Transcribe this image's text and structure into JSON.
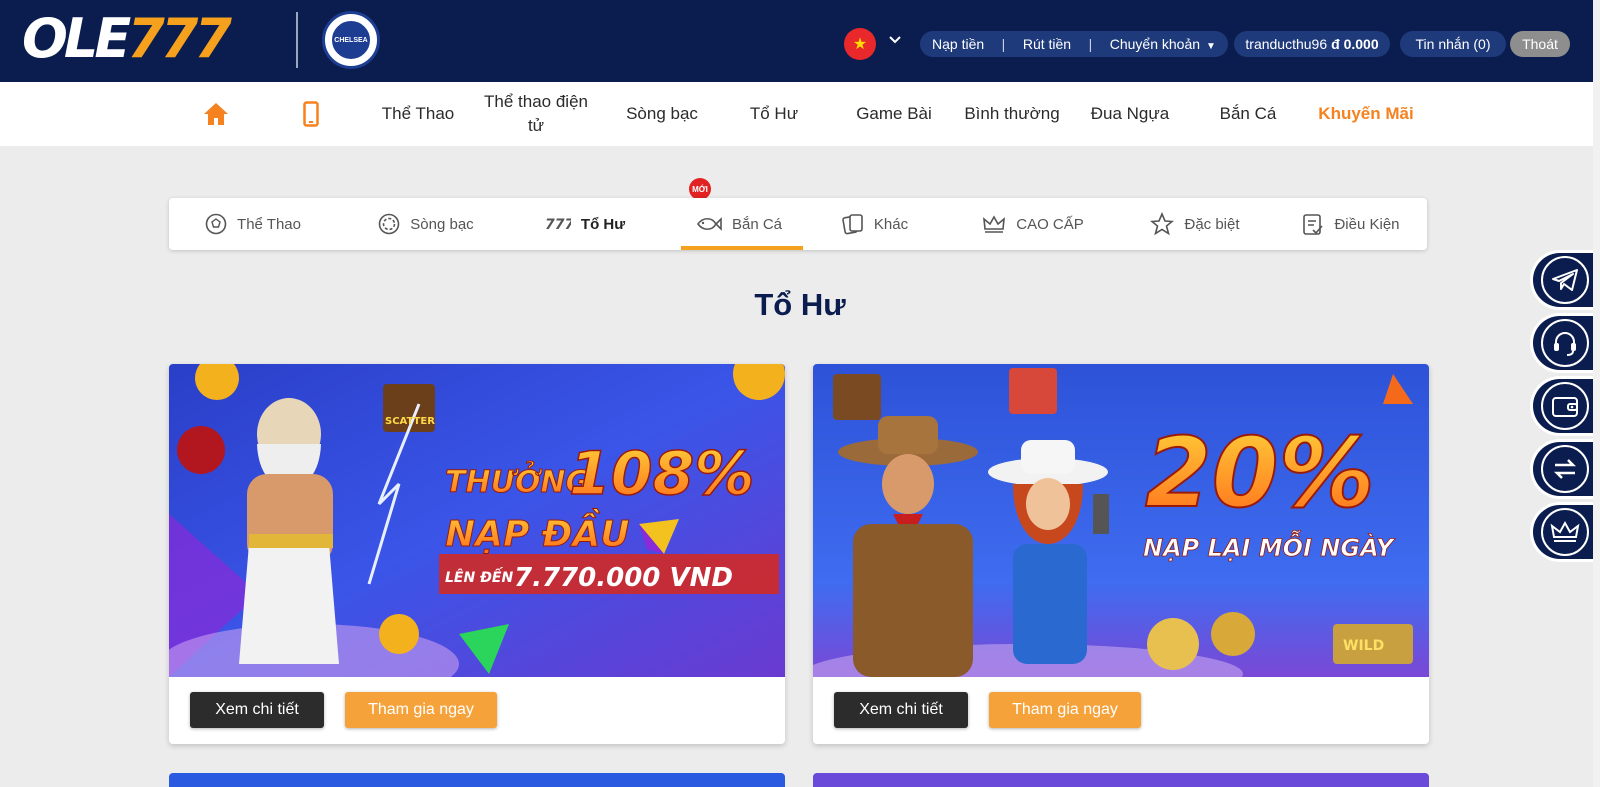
{
  "header": {
    "logo_ole": "OLE",
    "logo_777": "777",
    "club_text": "CHELSEA",
    "flag_star": "★",
    "deposit": "Nạp tiền",
    "withdraw": "Rút tiền",
    "transfer": "Chuyển khoản",
    "separator": "|",
    "username": "tranducthu96",
    "balance": "đ 0.000",
    "messages": "Tin nhắn (0)",
    "logout": "Thoát"
  },
  "nav": {
    "sports": "Thể Thao",
    "esports": "Thể thao điện tử",
    "casino": "Sòng bạc",
    "casino_badge": "MỚI",
    "slots": "Tổ Hư",
    "card_games": "Game Bài",
    "normal": "Bình thường",
    "horse_racing": "Đua Ngựa",
    "fishing": "Bắn Cá",
    "promotions": "Khuyến Mãi"
  },
  "tabs": [
    {
      "label": "Thể Thao",
      "icon": "soccer-ball-icon"
    },
    {
      "label": "Sòng bạc",
      "icon": "casino-chip-icon"
    },
    {
      "label": "Tổ Hư",
      "icon": "slot-777-icon"
    },
    {
      "label": "Bắn Cá",
      "icon": "fish-icon"
    },
    {
      "label": "Khác",
      "icon": "cards-icon"
    },
    {
      "label": "CAO CẤP",
      "icon": "crown-icon"
    },
    {
      "label": "Đặc biệt",
      "icon": "star-icon"
    },
    {
      "label": "Điều Kiện",
      "icon": "checklist-icon"
    }
  ],
  "section_title": "Tổ Hư",
  "cards": [
    {
      "banner_line1_prefix": "THƯỞNG",
      "banner_line1_value": "108%",
      "banner_line2": "NẠP ĐẦU",
      "banner_line3_prefix": "LÊN ĐẾN",
      "banner_line3_value": "7.770.000 VND",
      "badge_text": "SCATTER",
      "details_label": "Xem chi tiết",
      "join_label": "Tham gia ngay"
    },
    {
      "banner_value": "20%",
      "banner_line2": "NẠP LẠI MỖI NGÀY",
      "badge_text": "WILD",
      "details_label": "Xem chi tiết",
      "join_label": "Tham gia ngay"
    }
  ],
  "colors": {
    "header_bg": "#0a1d4e",
    "accent": "#f5a11e",
    "promo_nav": "#f5821f"
  }
}
